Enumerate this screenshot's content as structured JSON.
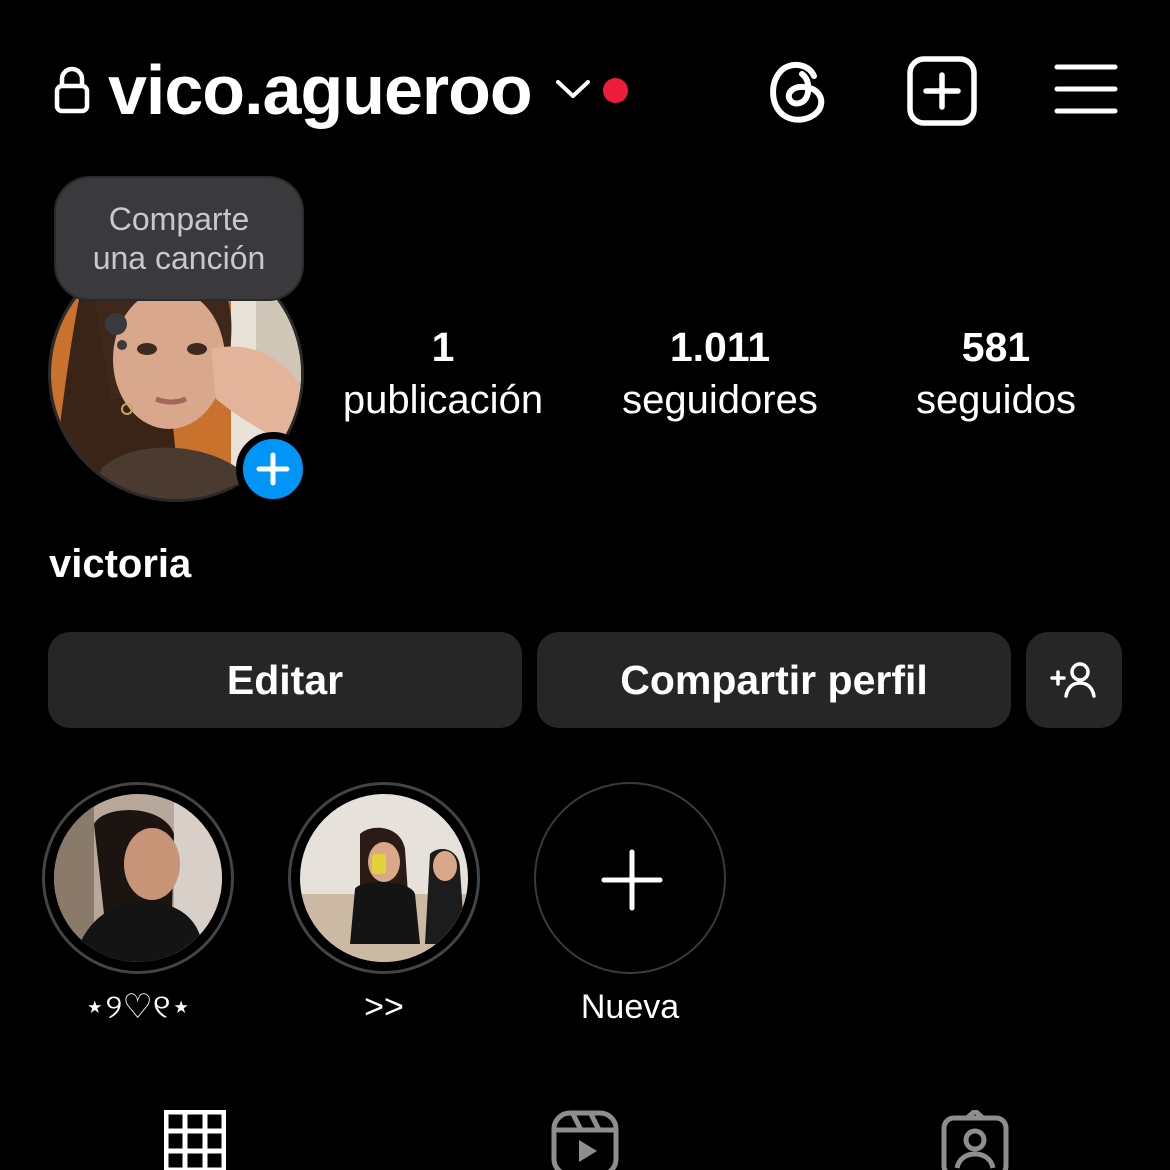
{
  "header": {
    "username": "vico.agueroo",
    "notification_color": "#ed1c3a",
    "icons": [
      "lock-icon",
      "chevron-down-icon",
      "threads-icon",
      "add-post-icon",
      "menu-icon"
    ]
  },
  "tooltip": {
    "line1": "Comparte",
    "line2": "una canción"
  },
  "profile": {
    "display_name": "victoria",
    "add_story_color": "#0095f6"
  },
  "stats": {
    "posts": {
      "value": "1",
      "label": "publicación"
    },
    "followers": {
      "value": "1.011",
      "label": "seguidores"
    },
    "following": {
      "value": "581",
      "label": "seguidos"
    }
  },
  "actions": {
    "edit_label": "Editar",
    "share_label": "Compartir perfil",
    "discover_icon": "add-person-icon"
  },
  "highlights": [
    {
      "label": "⋆୨♡୧⋆"
    },
    {
      "label": ">>"
    },
    {
      "label": "Nueva"
    }
  ],
  "tabs": [
    "grid-icon",
    "reels-icon",
    "tagged-icon"
  ]
}
